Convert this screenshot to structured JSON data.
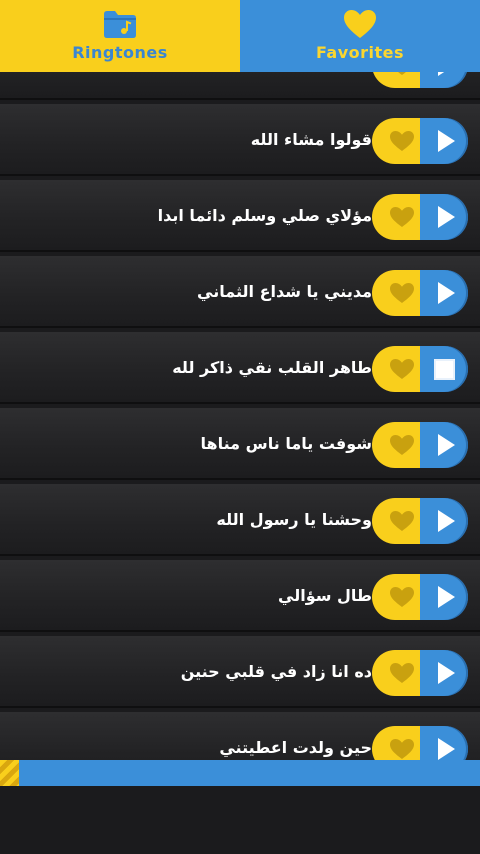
{
  "tabs": [
    {
      "label": "Ringtones",
      "icon": "folder-music-icon",
      "active": true
    },
    {
      "label": "Favorites",
      "icon": "heart-icon",
      "active": false
    }
  ],
  "colors": {
    "yellow": "#f9cf1c",
    "blue": "#3b8fd9",
    "heart": "#c9a10f",
    "row_dark": "#232325"
  },
  "ringtones": [
    {
      "title": "",
      "state": "play"
    },
    {
      "title": "قولوا مشاء الله",
      "state": "play"
    },
    {
      "title": "مؤلاي صلي وسلم دائما ابدا",
      "state": "play"
    },
    {
      "title": "مديني يا شداع الثماني",
      "state": "play"
    },
    {
      "title": "طاهر القلب نقي ذاكر لله",
      "state": "stop"
    },
    {
      "title": "شوفت ياما ناس مناها",
      "state": "play"
    },
    {
      "title": "وحشنا يا رسول الله",
      "state": "play"
    },
    {
      "title": "طال سؤالي",
      "state": "play"
    },
    {
      "title": "ده انا زاد في قلبي حنين",
      "state": "play"
    },
    {
      "title": "حين ولدت اعطيتني",
      "state": "play"
    }
  ],
  "progress": 0.04
}
